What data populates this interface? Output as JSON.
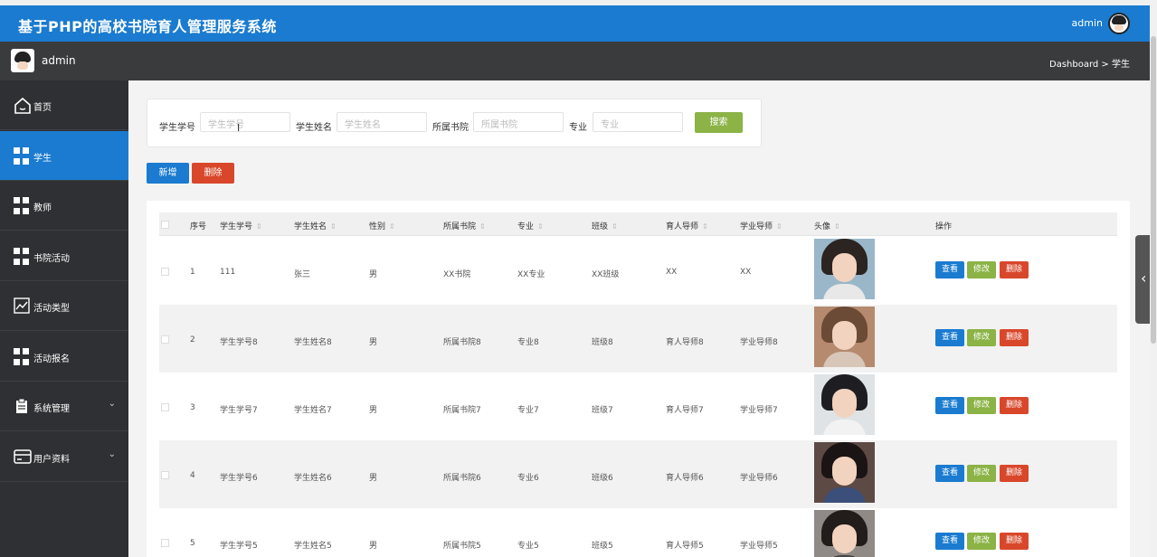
{
  "header": {
    "title": "基于PHP的高校书院育人管理服务系统",
    "user": "admin"
  },
  "subbar": {
    "username": "admin",
    "breadcrumb": "Dashboard > 学生"
  },
  "sidebar": {
    "items": [
      {
        "label": "首页",
        "icon": "home-icon"
      },
      {
        "label": "学生",
        "icon": "grid-icon",
        "active": true
      },
      {
        "label": "教师",
        "icon": "grid-icon"
      },
      {
        "label": "书院活动",
        "icon": "grid-icon"
      },
      {
        "label": "活动类型",
        "icon": "chart-icon"
      },
      {
        "label": "活动报名",
        "icon": "grid-icon"
      },
      {
        "label": "系统管理",
        "icon": "clipboard-icon",
        "chevron": "⌄"
      },
      {
        "label": "用户资料",
        "icon": "card-icon",
        "chevron": "⌄"
      }
    ]
  },
  "search": {
    "fields": [
      {
        "label": "学生学号",
        "placeholder": "学生学号"
      },
      {
        "label": "学生姓名",
        "placeholder": "学生姓名"
      },
      {
        "label": "所属书院",
        "placeholder": "所属书院"
      },
      {
        "label": "专业",
        "placeholder": "专业"
      }
    ],
    "button": "搜索"
  },
  "actions": {
    "add": "新增",
    "delete": "删除"
  },
  "table": {
    "headers": [
      "序号",
      "学生学号",
      "学生姓名",
      "性别",
      "所属书院",
      "专业",
      "班级",
      "育人导师",
      "学业导师",
      "头像",
      "操作"
    ],
    "row_buttons": {
      "view": "查看",
      "edit": "修改",
      "delete": "删除"
    },
    "rows": [
      {
        "no": "1",
        "sid": "111",
        "name": "张三",
        "gender": "男",
        "college": "XX书院",
        "major": "XX专业",
        "class": "XX班级",
        "mentor": "XX",
        "tutor": "XX"
      },
      {
        "no": "2",
        "sid": "学生学号8",
        "name": "学生姓名8",
        "gender": "男",
        "college": "所属书院8",
        "major": "专业8",
        "class": "班级8",
        "mentor": "育人导师8",
        "tutor": "学业导师8"
      },
      {
        "no": "3",
        "sid": "学生学号7",
        "name": "学生姓名7",
        "gender": "男",
        "college": "所属书院7",
        "major": "专业7",
        "class": "班级7",
        "mentor": "育人导师7",
        "tutor": "学业导师7"
      },
      {
        "no": "4",
        "sid": "学生学号6",
        "name": "学生姓名6",
        "gender": "男",
        "college": "所属书院6",
        "major": "专业6",
        "class": "班级6",
        "mentor": "育人导师6",
        "tutor": "学业导师6"
      },
      {
        "no": "5",
        "sid": "学生学号5",
        "name": "学生姓名5",
        "gender": "男",
        "college": "所属书院5",
        "major": "专业5",
        "class": "班级5",
        "mentor": "育人导师5",
        "tutor": "学业导师5"
      }
    ]
  },
  "colors": {
    "primary": "#1a7bd0",
    "success": "#8bb346",
    "danger": "#d9472b",
    "sidebar": "#2f3033"
  }
}
